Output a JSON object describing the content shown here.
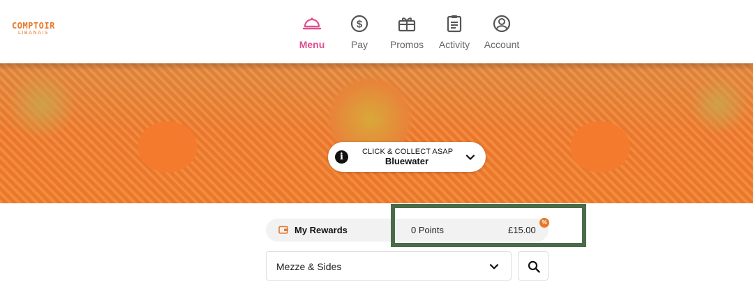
{
  "brand": {
    "name": "COMPTOIR",
    "subtitle": "LIBANAIS",
    "accent": "#e8782a"
  },
  "nav": {
    "items": [
      {
        "label": "Menu",
        "icon": "cloche-icon",
        "active": true
      },
      {
        "label": "Pay",
        "icon": "dollar-circle-icon",
        "active": false
      },
      {
        "label": "Promos",
        "icon": "gift-icon",
        "active": false
      },
      {
        "label": "Activity",
        "icon": "clipboard-icon",
        "active": false
      },
      {
        "label": "Account",
        "icon": "user-circle-icon",
        "active": false
      }
    ],
    "active_color": "#e0508f"
  },
  "order": {
    "mode": "CLICK & COLLECT  ASAP",
    "store": "Bluewater"
  },
  "rewards": {
    "label": "My Rewards",
    "points": "0 Points",
    "balance": "£15.00",
    "badge": "%"
  },
  "category": {
    "selected": "Mezze & Sides"
  },
  "colors": {
    "highlight": "#4a6b4a",
    "pink": "#e0508f",
    "orange": "#e8782a"
  }
}
